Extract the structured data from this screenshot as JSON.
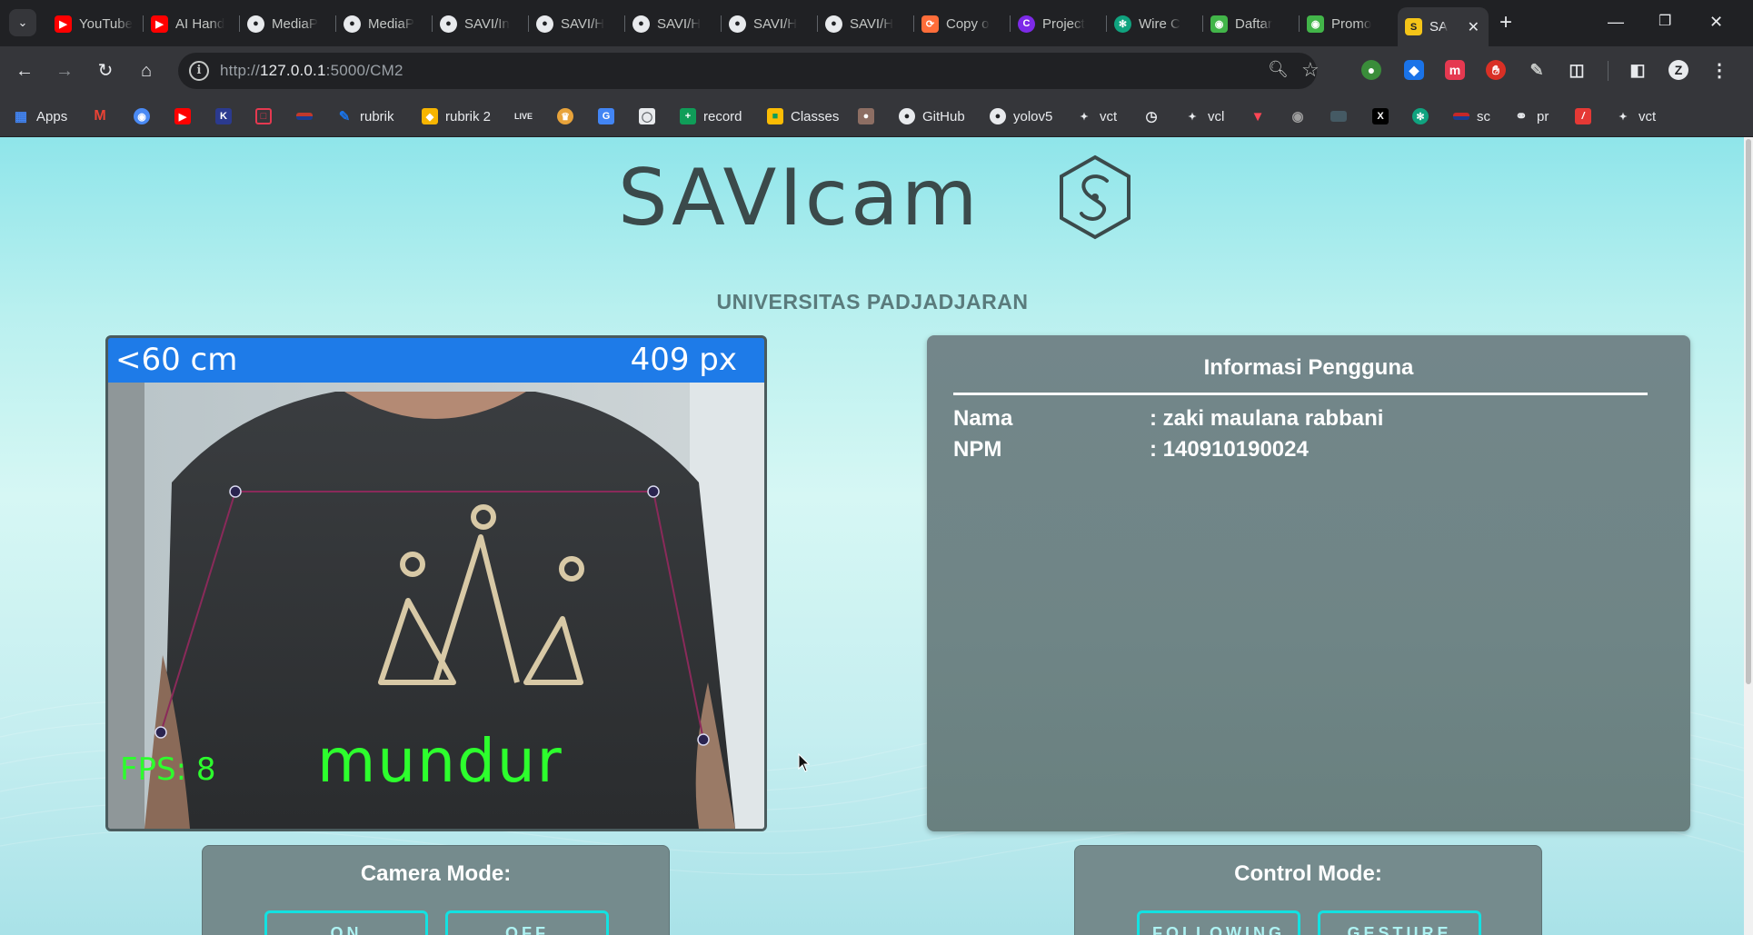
{
  "browser": {
    "tabs": [
      {
        "title": "YouTube",
        "icon": "youtube-icon",
        "color": "#ff0000"
      },
      {
        "title": "AI Hand",
        "icon": "youtube-icon",
        "color": "#ff0000"
      },
      {
        "title": "MediaP",
        "icon": "github-icon",
        "color": "#e8eaed"
      },
      {
        "title": "MediaP",
        "icon": "github-icon",
        "color": "#e8eaed"
      },
      {
        "title": "SAVI/In",
        "icon": "github-icon",
        "color": "#e8eaed"
      },
      {
        "title": "SAVI/H",
        "icon": "github-icon",
        "color": "#e8eaed"
      },
      {
        "title": "SAVI/H",
        "icon": "github-icon",
        "color": "#e8eaed"
      },
      {
        "title": "SAVI/H",
        "icon": "github-icon",
        "color": "#e8eaed"
      },
      {
        "title": "SAVI/H",
        "icon": "github-icon",
        "color": "#e8eaed"
      },
      {
        "title": "Copy o",
        "icon": "copy-icon",
        "color": "#ff6d3a"
      },
      {
        "title": "Project",
        "icon": "canva-icon",
        "color": "#7d2ae8"
      },
      {
        "title": "Wire C",
        "icon": "chatgpt-icon",
        "color": "#10a37f"
      },
      {
        "title": "Daftar",
        "icon": "tokopedia-icon",
        "color": "#42b549"
      },
      {
        "title": "Promo",
        "icon": "tokopedia-icon",
        "color": "#42b549"
      },
      {
        "title": "SA",
        "icon": "savicam-icon",
        "color": "#f5c518"
      }
    ],
    "address": {
      "scheme_host": "http://",
      "host": "127.0.0.1",
      "path": ":5000/CM2"
    },
    "bookmarks": [
      {
        "label": "Apps",
        "icon": "apps-grid-icon",
        "color": "#4285f4"
      },
      {
        "label": "",
        "icon": "gmail-icon",
        "color": "#ea4335"
      },
      {
        "label": "",
        "icon": "bot-icon",
        "color": "#4a8af4"
      },
      {
        "label": "",
        "icon": "youtube-icon",
        "color": "#ff0000"
      },
      {
        "label": "",
        "icon": "k-icon",
        "color": "#2b3a8f"
      },
      {
        "label": "",
        "icon": "slides-icon",
        "color": "#e53950"
      },
      {
        "label": "",
        "icon": "flag-icon",
        "color": "#c0392b"
      },
      {
        "label": "rubrik",
        "icon": "pen-icon",
        "color": "#1a73e8"
      },
      {
        "label": "rubrik 2",
        "icon": "sketch-icon",
        "color": "#f7b500"
      },
      {
        "label": "",
        "icon": "live-icon",
        "color": "#3c4043"
      },
      {
        "label": "",
        "icon": "crown-icon",
        "color": "#e8a33a"
      },
      {
        "label": "",
        "icon": "translate-icon",
        "color": "#4285f4"
      },
      {
        "label": "",
        "icon": "lens-icon",
        "color": "#5f6368"
      },
      {
        "label": "record",
        "icon": "plus-green-icon",
        "color": "#0f9d58"
      },
      {
        "label": "Classes",
        "icon": "classroom-icon",
        "color": "#fbbc04"
      },
      {
        "label": "",
        "icon": "image-icon",
        "color": "#8d6e63"
      },
      {
        "label": "GitHub",
        "icon": "github-icon",
        "color": "#e8eaed"
      },
      {
        "label": "yolov5",
        "icon": "github-icon",
        "color": "#e8eaed"
      },
      {
        "label": "vct",
        "icon": "valorant-icon",
        "color": "#e8eaed"
      },
      {
        "label": "",
        "icon": "clock-icon",
        "color": "#e8eaed"
      },
      {
        "label": "vcl",
        "icon": "valorant-icon",
        "color": "#e8eaed"
      },
      {
        "label": "",
        "icon": "diamond-icon",
        "color": "#ff4655"
      },
      {
        "label": "",
        "icon": "panda-icon",
        "color": "#9e9e9e"
      },
      {
        "label": "",
        "icon": "tank-icon",
        "color": "#607d8b"
      },
      {
        "label": "",
        "icon": "x-icon",
        "color": "#000000"
      },
      {
        "label": "",
        "icon": "chatgpt-icon",
        "color": "#10a37f"
      },
      {
        "label": "sc",
        "icon": "flag-red-icon",
        "color": "#c62828"
      },
      {
        "label": "pr",
        "icon": "globe-icon",
        "color": "#e8eaed"
      },
      {
        "label": "",
        "icon": "adobe-icon",
        "color": "#e53935"
      },
      {
        "label": "vct",
        "icon": "valorant-icon",
        "color": "#e8eaed"
      }
    ]
  },
  "page": {
    "logo_text": "SAVIcam",
    "university": "UNIVERSITAS PADJADJARAN",
    "camera": {
      "distance_label": "<60 cm",
      "pixel_label": "409 px",
      "fps_label": "FPS: 8",
      "command_label": "mundur"
    },
    "user_info": {
      "title": "Informasi Pengguna",
      "rows": [
        {
          "key": "Nama",
          "value": ": zaki maulana rabbani"
        },
        {
          "key": "NPM",
          "value": ": 140910190024"
        }
      ]
    },
    "camera_mode": {
      "title": "Camera Mode:",
      "buttons": [
        "ON",
        "OFF"
      ]
    },
    "control_mode": {
      "title": "Control Mode:",
      "buttons": [
        "FOLLOWING",
        "GESTURE"
      ]
    }
  }
}
